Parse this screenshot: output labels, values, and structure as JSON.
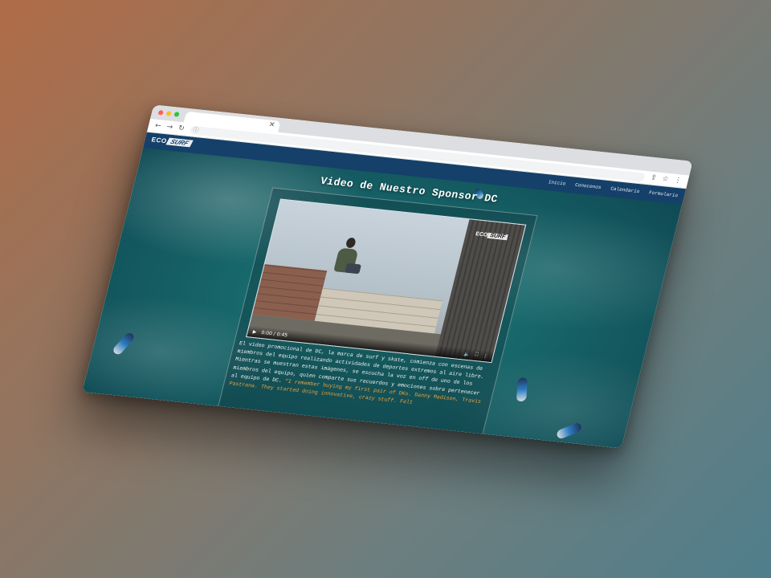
{
  "browser": {
    "tab": {
      "close_icon": "close-icon"
    },
    "toolbar": {
      "back_icon": "arrow-left-icon",
      "forward_icon": "arrow-right-icon",
      "reload_icon": "reload-icon",
      "share_icon": "share-icon",
      "bookmark_icon": "star-icon",
      "menu_icon": "kebab-menu-icon"
    }
  },
  "site": {
    "logo": {
      "eco": "ECO",
      "surf": "SURF"
    },
    "nav": [
      {
        "label": "Inicio"
      },
      {
        "label": "Conocenos"
      },
      {
        "label": "Calendario"
      },
      {
        "label": "Formulario"
      }
    ],
    "page_title": "Video de Nuestro Sponsor DC",
    "video": {
      "logo_eco": "ECO",
      "logo_surf": "SURF",
      "time": "0:00 / 0:45",
      "play_icon": "play-icon",
      "volume_icon": "volume-icon",
      "fullscreen_icon": "fullscreen-icon",
      "more_icon": "kebab-menu-icon"
    },
    "description": {
      "text": "El video promocional de DC, la marca de surf y skate, comienza con escenas de miembros del equipo realizando actividades de deportes extremos al aire libre. Mientras se muestran estas imágenes, se escucha la voz en off de uno de los miembros del equipo, quien comparte sus recuerdos y emociones sobre pertenecer al equipo de DC. ",
      "quote": "\"I remember buying my first pair of DKs. Danny Madison, Travis Pastrana. They started doing innovative, crazy stuff. Felt"
    }
  }
}
